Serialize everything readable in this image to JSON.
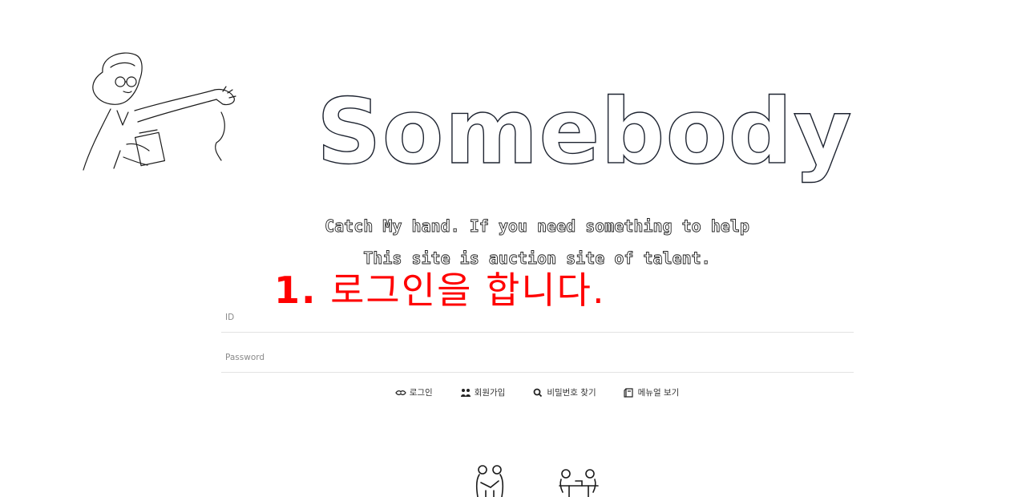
{
  "logo": {
    "text": "Somebody"
  },
  "taglines": {
    "line1": "Catch My hand. If you need something to help",
    "line2": "This site is auction site of talent."
  },
  "annotation": {
    "number": "1.",
    "text": "로그인을 합니다.",
    "color": "#ff0000"
  },
  "login": {
    "id_placeholder": "ID",
    "password_placeholder": "Password"
  },
  "actions": {
    "login": "로그인",
    "signup": "회원가입",
    "find_password": "비밀번호 찾기",
    "manual": "메뉴얼 보기"
  },
  "icons": {
    "login": "handshake-icon",
    "signup": "users-icon",
    "find_password": "search-icon",
    "manual": "book-icon"
  }
}
